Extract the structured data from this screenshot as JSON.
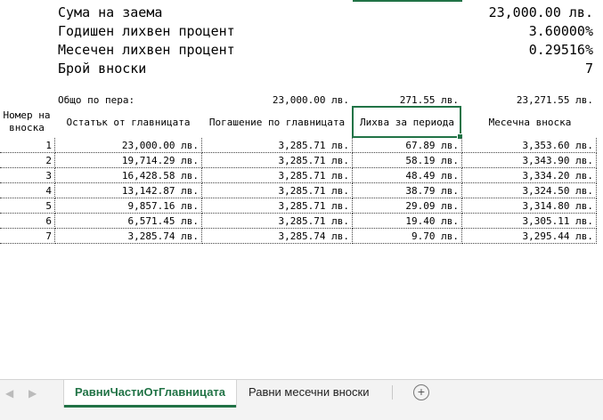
{
  "summary": [
    {
      "label": "Сума на заема",
      "value": "23,000.00 лв."
    },
    {
      "label": "Годишен лихвен процент",
      "value": "3.60000%"
    },
    {
      "label": "Месечен лихвен процент",
      "value": "0.29516%"
    },
    {
      "label": "Брой вноски",
      "value": "7"
    }
  ],
  "totals": {
    "label": "Общо по пера:",
    "principal": "23,000.00 лв.",
    "interest": "271.55 лв.",
    "payment": "23,271.55 лв."
  },
  "table": {
    "headers": {
      "number": "Номер на вноска",
      "balance": "Остатък от главницата",
      "principal": "Погашение по главницата",
      "interest": "Лихва за периода",
      "payment": "Месечна вноска"
    },
    "rows": [
      [
        "1",
        "23,000.00 лв.",
        "3,285.71 лв.",
        "67.89 лв.",
        "3,353.60 лв."
      ],
      [
        "2",
        "19,714.29 лв.",
        "3,285.71 лв.",
        "58.19 лв.",
        "3,343.90 лв."
      ],
      [
        "3",
        "16,428.58 лв.",
        "3,285.71 лв.",
        "48.49 лв.",
        "3,334.20 лв."
      ],
      [
        "4",
        "13,142.87 лв.",
        "3,285.71 лв.",
        "38.79 лв.",
        "3,324.50 лв."
      ],
      [
        "5",
        "9,857.16 лв.",
        "3,285.71 лв.",
        "29.09 лв.",
        "3,314.80 лв."
      ],
      [
        "6",
        "6,571.45 лв.",
        "3,285.71 лв.",
        "19.40 лв.",
        "3,305.11 лв."
      ],
      [
        "7",
        "3,285.74 лв.",
        "3,285.74 лв.",
        "9.70 лв.",
        "3,295.44 лв."
      ]
    ]
  },
  "tabs": {
    "active": "РавниЧастиОтГлавницата",
    "other": "Равни месечни вноски",
    "add": "+"
  },
  "nav": {
    "prev": "◀",
    "next": "▶"
  },
  "colors": {
    "accent": "#217346"
  }
}
